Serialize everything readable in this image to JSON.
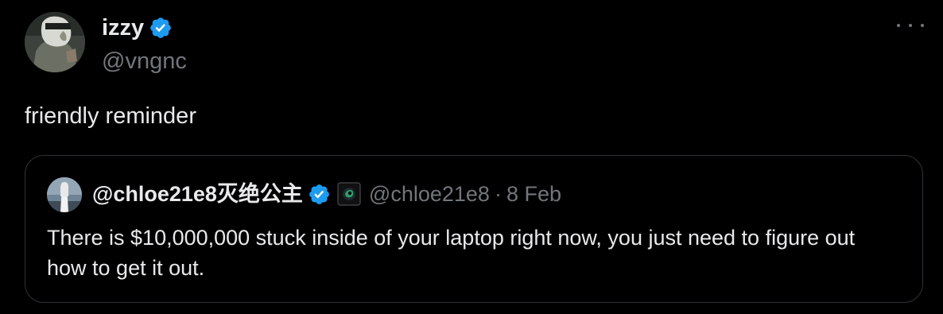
{
  "tweet": {
    "author": {
      "name": "izzy",
      "handle": "@vngnc",
      "verified": true,
      "avatar_icon": "avatar-illustrated-figure"
    },
    "more_icon": "more-horizontal-icon",
    "text": "friendly reminder",
    "quoted": {
      "author": {
        "name": "@chloe21e8灭绝公主",
        "handle": "@chloe21e8",
        "verified": true,
        "affiliate_badge_icon": "affiliate-badge-icon",
        "avatar_icon": "avatar-figure-silhouette"
      },
      "separator": "·",
      "date": "8 Feb",
      "text": "There is $10,000,000 stuck inside of your laptop right now, you just need to figure out how to get it out."
    }
  },
  "colors": {
    "background": "#000000",
    "primary_text": "#e7e9ea",
    "secondary_text": "#71767b",
    "border": "#2f3336",
    "verified_blue": "#1d9bf0"
  }
}
